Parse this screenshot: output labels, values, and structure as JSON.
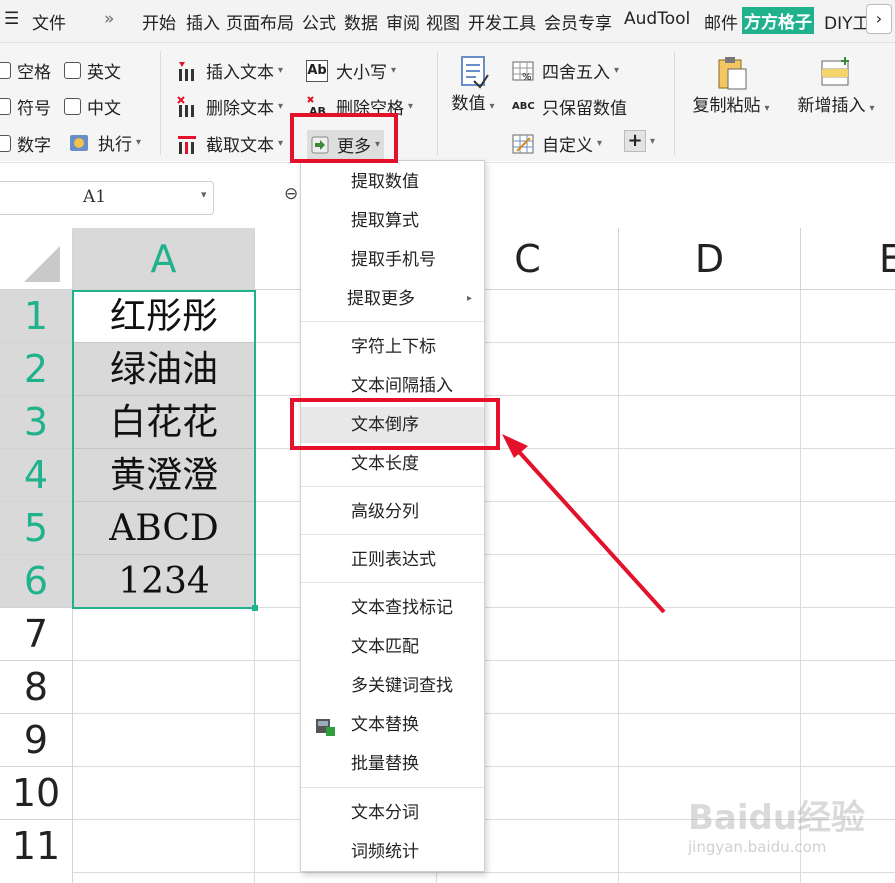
{
  "menubar": {
    "file": "文件",
    "more": "»",
    "tabs": [
      "开始",
      "插入",
      "页面布局",
      "公式",
      "数据",
      "审阅",
      "视图",
      "开发工具",
      "会员专享",
      "AudTool",
      "邮件",
      "方方格子",
      "DIY工",
      "›"
    ]
  },
  "ribbon": {
    "checks": [
      "空格",
      "英文",
      "符号",
      "中文",
      "数字"
    ],
    "execute": "执行",
    "insert_text": "插入文本",
    "delete_text": "删除文本",
    "cut_text": "截取文本",
    "case": "大小写",
    "delete_space": "删除空格",
    "more": "更多",
    "number": "数值",
    "round": "四舍五入",
    "keep_value": "只保留数值",
    "custom": "自定义",
    "copy_paste": "复制粘贴",
    "add_insert": "新增插入",
    "ab_icon_text": "Ab",
    "abc_icon_text": "ABC",
    "plus": "+"
  },
  "namebox": {
    "value": "A1"
  },
  "columns": [
    "A",
    "C",
    "D",
    "E"
  ],
  "rows": [
    "1",
    "2",
    "3",
    "4",
    "5",
    "6",
    "7",
    "8",
    "9",
    "10",
    "11"
  ],
  "cells_a": [
    "红彤彤",
    "绿油油",
    "白花花",
    "黄澄澄",
    "ABCD",
    "1234"
  ],
  "menu": {
    "items": [
      "提取数值",
      "提取算式",
      "提取手机号",
      "提取更多",
      "字符上下标",
      "文本间隔插入",
      "文本倒序",
      "文本长度",
      "高级分列",
      "正则表达式",
      "文本查找标记",
      "文本匹配",
      "多关键词查找",
      "文本替换",
      "批量替换",
      "文本分词",
      "词频统计"
    ]
  },
  "watermark": {
    "brand": "Baidu经验",
    "url": "jingyan.baidu.com"
  },
  "colors": {
    "accent": "#1fb28c",
    "highlight": "#e3122a",
    "selected_fill": "#d9d9d9"
  }
}
